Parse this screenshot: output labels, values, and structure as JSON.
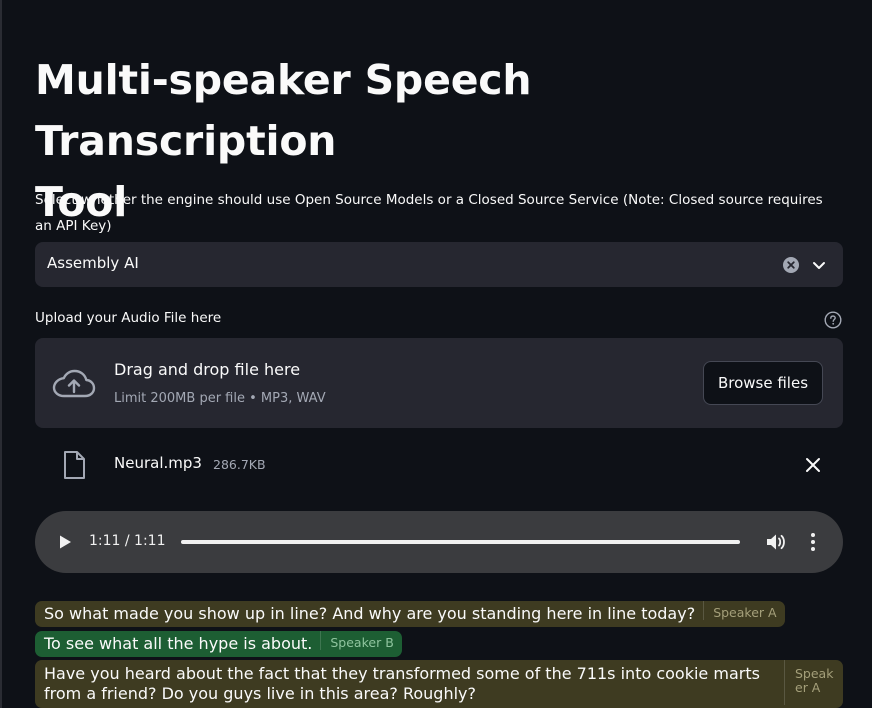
{
  "page": {
    "title_line1": "Multi-speaker Speech Transcription",
    "title_line2": "Tool",
    "description": "Select whether the engine should use Open Source Models or a Closed Source Service (Note: Closed source requires an API Key)"
  },
  "engine_select": {
    "value": "Assembly AI",
    "clear_icon": "clear-circle-icon",
    "dropdown_icon": "chevron-down-icon"
  },
  "uploader": {
    "label": "Upload your Audio File here",
    "help_icon": "question-circle-icon",
    "drop_title": "Drag and drop file here",
    "drop_hint": "Limit 200MB per file • MP3, WAV",
    "browse_label": "Browse files",
    "cloud_icon": "cloud-upload-icon"
  },
  "uploaded_file": {
    "name": "Neural.mp3",
    "size": "286.7KB",
    "file_icon": "file-icon",
    "remove_icon": "close-icon"
  },
  "audio_player": {
    "time": "1:11 / 1:11",
    "progress": 1.0,
    "play_icon": "play-icon",
    "volume_icon": "volume-icon",
    "more_icon": "more-vertical-icon"
  },
  "transcript": [
    {
      "text": "So what made you show up in line? And why are you standing here in line today?",
      "speaker": "Speaker A"
    },
    {
      "text": "To see what all the hype is about.",
      "speaker": "Speaker B"
    },
    {
      "text": "Have you heard about the fact that they transformed some of the 711s into cookie marts from a friend? Do you guys live in this area? Roughly?",
      "speaker": "Speak er A"
    }
  ],
  "colors": {
    "background": "#0e1117",
    "surface": "#262730",
    "speaker_a_bg": "#3e3b21",
    "speaker_b_bg": "#1d5e33",
    "player_bg": "#3b3c3f"
  }
}
